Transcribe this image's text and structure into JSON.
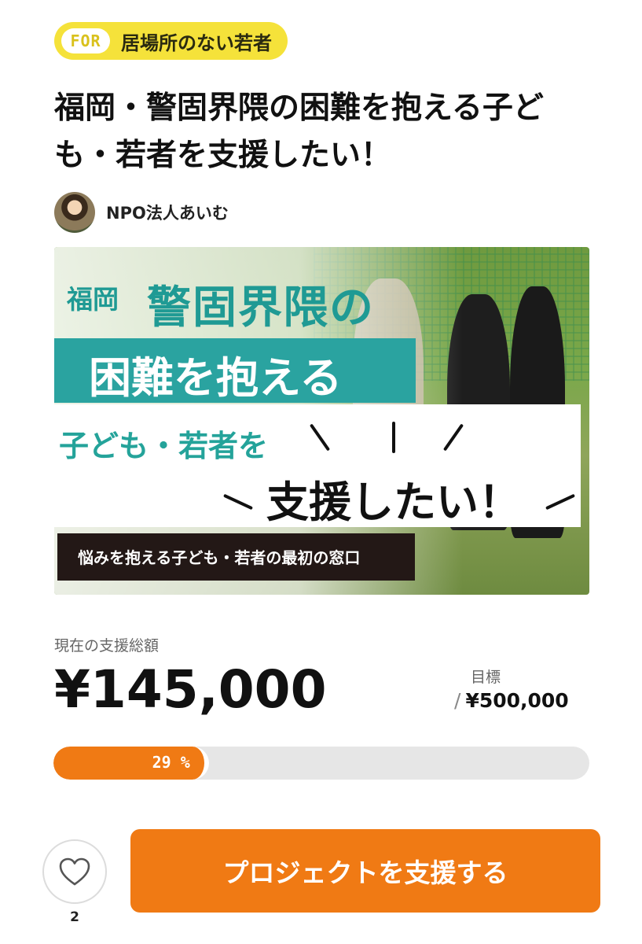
{
  "category": {
    "prefix": "FOR",
    "label": "居場所のない若者",
    "color": "#f5e23a"
  },
  "project": {
    "title": "福岡・警固界隈の困難を抱える子ども・若者を支援したい！",
    "owner": "NPO法人あいむ"
  },
  "hero": {
    "prefecture": "福岡",
    "headline": "警固界隈の",
    "band1": "困難を抱える",
    "subline": "子ども・若者を",
    "bigline": "支援したい！",
    "caption": "悩みを抱える子ども・若者の最初の窓口"
  },
  "funding": {
    "total_label": "現在の支援総額",
    "total_amount": "¥145,000",
    "goal_label": "目標",
    "goal_slash": "/",
    "goal_amount": "¥500,000",
    "progress_percent": 29,
    "progress_text": "29 %"
  },
  "actions": {
    "favorite_count": "2",
    "support_label": "プロジェクトを支援する",
    "accent_color": "#f07a14"
  }
}
